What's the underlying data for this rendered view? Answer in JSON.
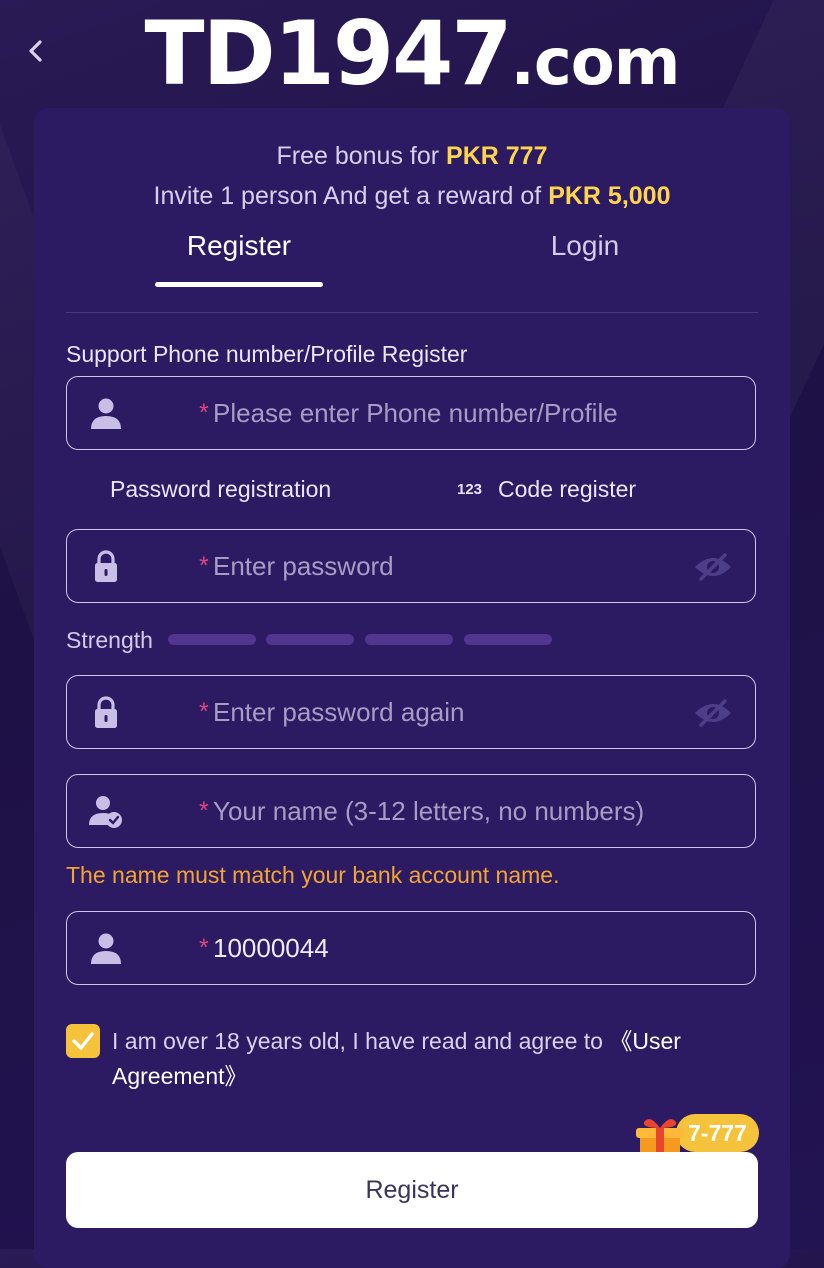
{
  "header": {
    "logo_main": "TD1947",
    "logo_domain": ".com"
  },
  "promo": {
    "line1_prefix": "Free bonus for ",
    "line1_amount": "PKR 777",
    "line2_prefix": "Invite 1 person And get a reward of ",
    "line2_amount": "PKR 5,000"
  },
  "tabs": [
    {
      "label": "Register",
      "active": true
    },
    {
      "label": "Login",
      "active": false
    }
  ],
  "form": {
    "support_label": "Support Phone number/Profile Register",
    "phone": {
      "placeholder": "Please enter Phone number/Profile",
      "value": ""
    },
    "reg_options": {
      "password": "Password registration",
      "code_badge": "123",
      "code": "Code register"
    },
    "password": {
      "placeholder": "Enter password",
      "value": ""
    },
    "strength_label": "Strength",
    "password_again": {
      "placeholder": "Enter password again",
      "value": ""
    },
    "name": {
      "placeholder": "Your name (3-12 letters, no numbers)",
      "value": ""
    },
    "name_warning": "The name must match your bank account name.",
    "referral": {
      "placeholder": "",
      "value": "10000044"
    },
    "required_mark": "*",
    "agreement": {
      "checked": true,
      "text": "I am over 18 years old, I have read and agree to ",
      "link": "《User Agreement》"
    },
    "gift_badge": "7-777",
    "submit_label": "Register"
  },
  "colors": {
    "background": "#221352",
    "card": "#2c1a63",
    "highlight": "#ffd54d",
    "warning": "#f2a531",
    "required": "#e0457a",
    "checkbox": "#f5c23b",
    "strength_bar": "#51358e"
  },
  "icons": {
    "back": "chevron-left-icon",
    "phone_field": "user-icon",
    "password_field": "lock-icon",
    "password_toggle": "eye-off-icon",
    "name_field": "user-check-icon",
    "referral_field": "user-icon",
    "checkbox": "check-icon",
    "gift": "gift-icon"
  }
}
